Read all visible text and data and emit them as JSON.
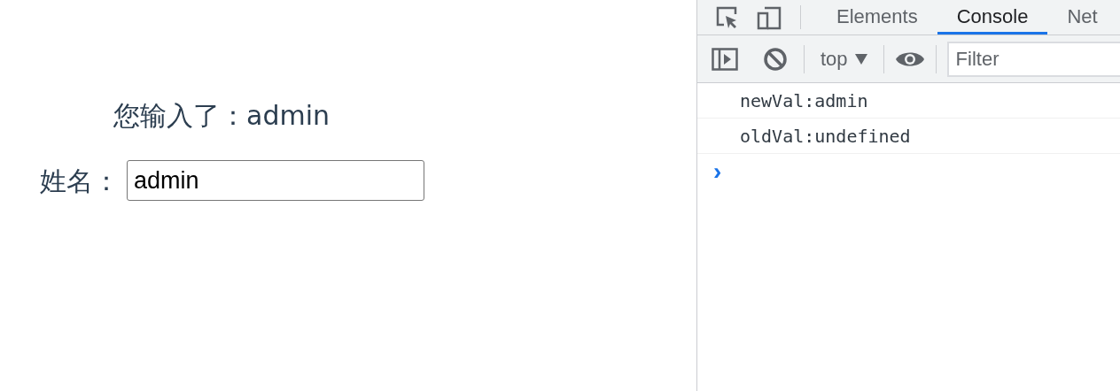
{
  "app": {
    "message": "您输入了：admin",
    "name_label": "姓名：",
    "name_field": {
      "value": "admin"
    }
  },
  "devtools": {
    "tabs": [
      {
        "label": "Elements",
        "selected": false
      },
      {
        "label": "Console",
        "selected": true
      },
      {
        "label": "Net",
        "selected": false
      }
    ],
    "context": "top",
    "filter": {
      "placeholder": "Filter"
    },
    "console_lines": [
      "newVal:admin",
      "oldVal:undefined"
    ],
    "prompt": "›"
  }
}
